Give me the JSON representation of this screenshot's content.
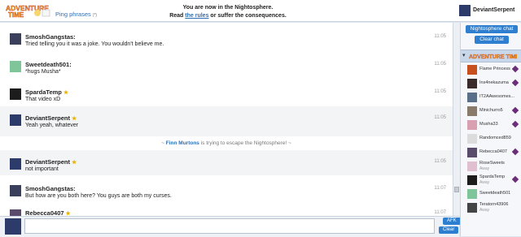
{
  "header": {
    "logo_alt": "Adventure Time",
    "ping_phrases": "Ping phrases",
    "ping_ext": "(*)",
    "topic_line1": "You are now in the Nightosphere.",
    "topic_read": "Read",
    "topic_rules": "the rules",
    "topic_rest": "or suffer the consequences.",
    "current_user": "DeviantSerpent"
  },
  "messages": [
    {
      "user": "SmoshGangstas:",
      "star": false,
      "text": "Tried telling you it was a joke. You wouldn't believe me.",
      "time": "11:05",
      "avatar_color": "#3a3f5c"
    },
    {
      "user": "Sweetdeath501:",
      "star": false,
      "text": "*hugs Musha*",
      "time": "11:05",
      "avatar_color": "#7fc59a"
    },
    {
      "user": "SpardaTemp",
      "star": true,
      "text": "That video xD",
      "time": "11:05",
      "avatar_color": "#1c1c1c"
    },
    {
      "user": "DeviantSerpent",
      "star": true,
      "text": "Yeah yeah, whatever",
      "time": "11:05",
      "avatar_color": "#2d3b6b"
    },
    {
      "user": "DeviantSerpent",
      "star": true,
      "text": "not important",
      "time": "11:05",
      "avatar_color": "#2d3b6b"
    },
    {
      "user": "SmoshGangstas:",
      "star": false,
      "text": "But how are you both here? You guys are both my curses.",
      "time": "11:07",
      "avatar_color": "#3a3f5c"
    },
    {
      "user": "Rebecca0407",
      "star": true,
      "text": "",
      "time": "11:07",
      "avatar_color": "#5a4a6b"
    }
  ],
  "inline_alert": {
    "prefix": "~",
    "name": "Finn Murtons",
    "text": "is trying to escape the Nightosphere!",
    "suffix": "~"
  },
  "input": {
    "placeholder": "",
    "afk_label": "AFK",
    "clear_label": "Clear"
  },
  "rail": {
    "room_button": "Nightosphere chat",
    "clear_chat": "Clear chat",
    "users": [
      {
        "name": "Flame Princess",
        "status": "",
        "color": "#c8501e"
      },
      {
        "name": "Ins4nekazuma",
        "status": "",
        "color": "#3a2a2a"
      },
      {
        "name": "IT2AAwesomes...",
        "status": "",
        "color": "#5a6f8a"
      },
      {
        "name": "Minichurro5",
        "status": "",
        "color": "#8a7a6a"
      },
      {
        "name": "Musha33",
        "status": "",
        "color": "#d8a0b0"
      },
      {
        "name": "Randomced859",
        "status": "",
        "color": "#dcdcdc"
      },
      {
        "name": "Rebecca0407",
        "status": "",
        "color": "#5a4a6b"
      },
      {
        "name": "RoseSweets",
        "status": "Away",
        "color": "#e0c0d0"
      },
      {
        "name": "SpardaTemp",
        "status": "Away",
        "color": "#1c1c1c"
      },
      {
        "name": "Sweetdeath501",
        "status": "",
        "color": "#7fc59a"
      },
      {
        "name": "Teratorn43906",
        "status": "Away",
        "color": "#444444"
      }
    ]
  },
  "colors": {
    "accent": "#2f7fd0",
    "link": "#2f6fb4",
    "diamond": "#6b2c7a"
  }
}
